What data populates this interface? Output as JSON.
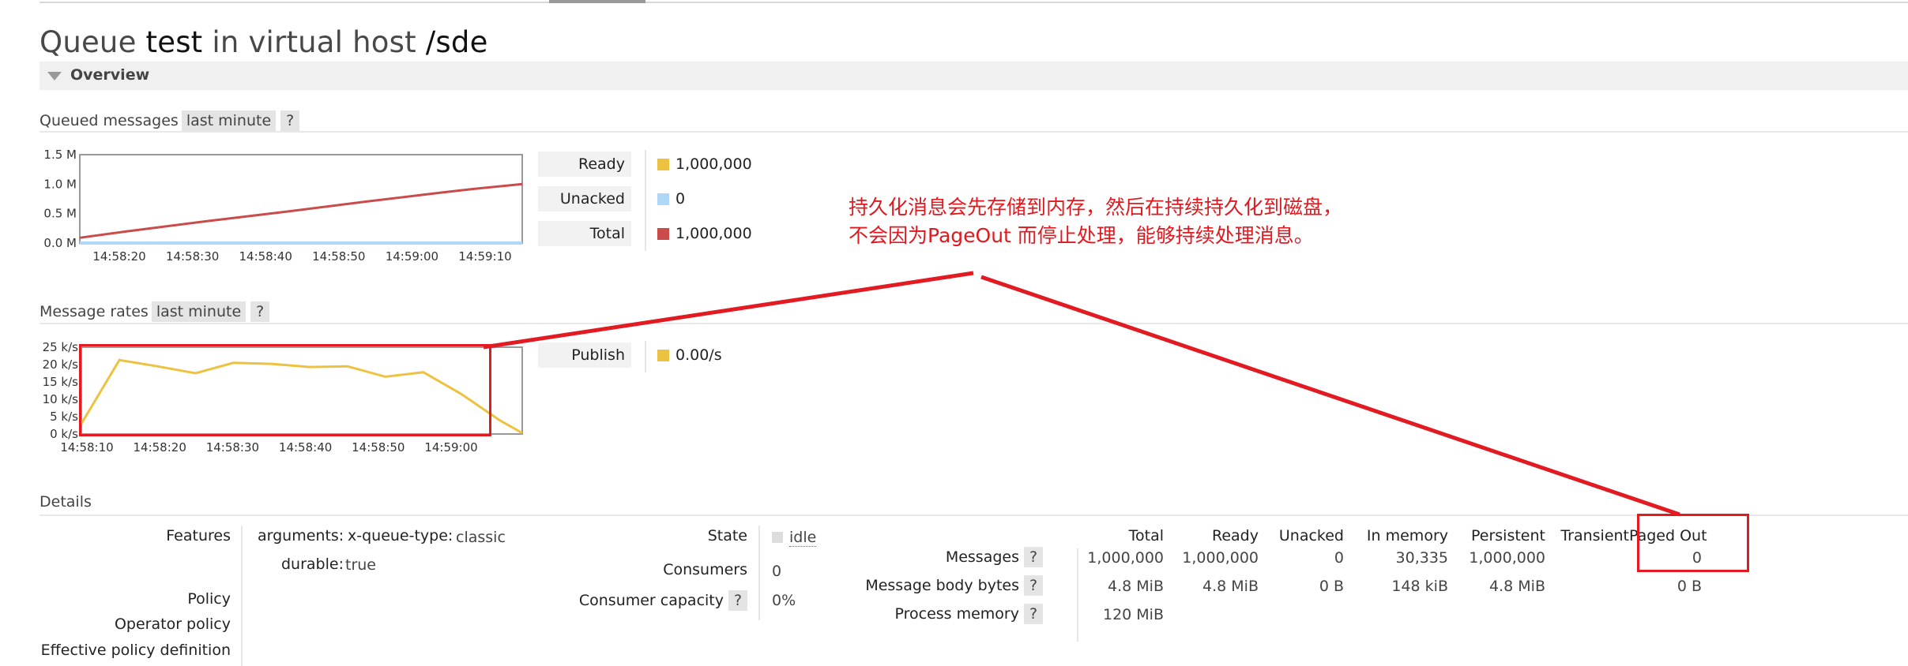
{
  "header": {
    "title_parts": [
      "Queue",
      "test",
      "in virtual host",
      "/sde"
    ],
    "overview_label": "Overview"
  },
  "queued": {
    "label": "Queued messages",
    "range": "last minute",
    "help": "?",
    "legend": [
      {
        "label": "Ready",
        "value": "1,000,000",
        "color": "#edc240"
      },
      {
        "label": "Unacked",
        "value": "0",
        "color": "#afd8f8"
      },
      {
        "label": "Total",
        "value": "1,000,000",
        "color": "#cb4b4b"
      }
    ]
  },
  "rates": {
    "label": "Message rates",
    "range": "last minute",
    "help": "?",
    "legend": [
      {
        "label": "Publish",
        "value": "0.00/s",
        "color": "#edc240"
      }
    ]
  },
  "annotation": {
    "line1": "持久化消息会先存储到内存，然后在持续持久化到磁盘，",
    "line2": "不会因为PageOut 而停止处理，能够持续处理消息。",
    "color": "#e21a22"
  },
  "details": {
    "label": "Details",
    "features_label": "Features",
    "arguments_label": "arguments:",
    "arg_key": "x-queue-type:",
    "arg_value": "classic",
    "durable_label": "durable:",
    "durable_value": "true",
    "policy_label": "Policy",
    "operator_policy_label": "Operator policy",
    "effective_policy_label": "Effective policy definition",
    "state_label": "State",
    "state_value": "idle",
    "consumers_label": "Consumers",
    "consumers_value": "0",
    "capacity_label": "Consumer capacity",
    "capacity_help": "?",
    "capacity_value": "0%",
    "table": {
      "columns": [
        "Total",
        "Ready",
        "Unacked",
        "In memory",
        "Persistent",
        "Transient",
        "Paged Out"
      ],
      "rows": [
        {
          "label": "Messages",
          "help": "?",
          "cells": [
            "1,000,000",
            "1,000,000",
            "0",
            "30,335",
            "1,000,000",
            "",
            "0"
          ]
        },
        {
          "label": "Message body bytes",
          "help": "?",
          "cells": [
            "4.8 MiB",
            "4.8 MiB",
            "0 B",
            "148 kiB",
            "4.8 MiB",
            "",
            "0 B"
          ]
        },
        {
          "label": "Process memory",
          "help": "?",
          "cells": [
            "120 MiB",
            "",
            "",
            "",
            "",
            "",
            ""
          ]
        }
      ]
    }
  },
  "chart_data": [
    {
      "type": "line",
      "xticks": [
        "14:58:20",
        "14:58:30",
        "14:58:40",
        "14:58:50",
        "14:59:00",
        "14:59:10"
      ],
      "yticks": [
        "1.5 M",
        "1.0 M",
        "0.5 M",
        "0.0 M"
      ],
      "ylim": [
        0,
        1.5
      ],
      "xlim": [
        14,
        70
      ],
      "series": [
        {
          "name": "Total",
          "color": "#cb4b4b",
          "x": [
            14,
            20,
            30,
            40,
            50,
            60,
            64,
            70
          ],
          "y": [
            0.09,
            0.2,
            0.37,
            0.53,
            0.7,
            0.86,
            0.92,
            1.0
          ]
        },
        {
          "name": "Unacked",
          "color": "#afd8f8",
          "x": [
            14,
            70
          ],
          "y": [
            0,
            0
          ]
        }
      ]
    },
    {
      "type": "line",
      "xticks": [
        "14:58:10",
        "14:58:20",
        "14:58:30",
        "14:58:40",
        "14:58:50",
        "14:59:00"
      ],
      "yticks": [
        "25 k/s",
        "20 k/s",
        "15 k/s",
        "10 k/s",
        "5 k/s",
        "0 k/s"
      ],
      "ylim": [
        0,
        25
      ],
      "xlim": [
        10,
        68
      ],
      "series": [
        {
          "name": "Publish",
          "color": "#edc240",
          "x": [
            10,
            15,
            20,
            25,
            30,
            35,
            40,
            45,
            50,
            55,
            60,
            65,
            68
          ],
          "y": [
            3,
            21.3,
            19.5,
            17.5,
            20.5,
            20.2,
            19.3,
            19.5,
            16.5,
            17.8,
            11.5,
            4,
            0.3
          ]
        }
      ]
    }
  ]
}
